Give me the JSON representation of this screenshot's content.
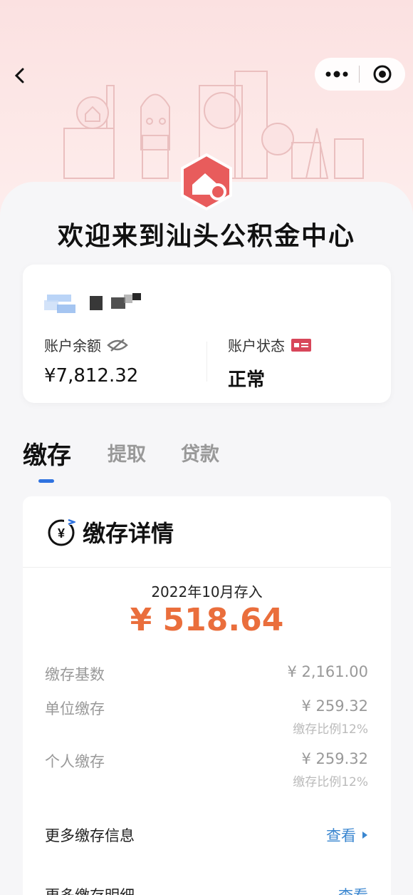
{
  "header": {
    "welcome": "欢迎来到汕头公积金中心"
  },
  "account": {
    "name_masked": "",
    "balance_label": "账户余额",
    "balance_value": "¥7,812.32",
    "status_label": "账户状态",
    "status_value": "正常"
  },
  "tabs": [
    {
      "label": "缴存",
      "active": true
    },
    {
      "label": "提取",
      "active": false
    },
    {
      "label": "贷款",
      "active": false
    }
  ],
  "detail": {
    "title": "缴存详情",
    "period": "2022年10月存入",
    "total": "¥ 518.64",
    "rows": [
      {
        "label": "缴存基数",
        "value": "¥ 2,161.00",
        "sub": ""
      },
      {
        "label": "单位缴存",
        "value": "¥ 259.32",
        "sub": "缴存比例12%"
      },
      {
        "label": "个人缴存",
        "value": "¥ 259.32",
        "sub": "缴存比例12%"
      }
    ],
    "links": [
      {
        "label": "更多缴存信息",
        "action": "查看"
      },
      {
        "label": "更多缴存明细",
        "action": "查看"
      }
    ]
  },
  "colors": {
    "accent": "#2f73e0",
    "amount": "#ea6e3c",
    "link": "#3a86d0",
    "logo": "#e85c5c",
    "hero_bg": "#fbe1e1"
  }
}
